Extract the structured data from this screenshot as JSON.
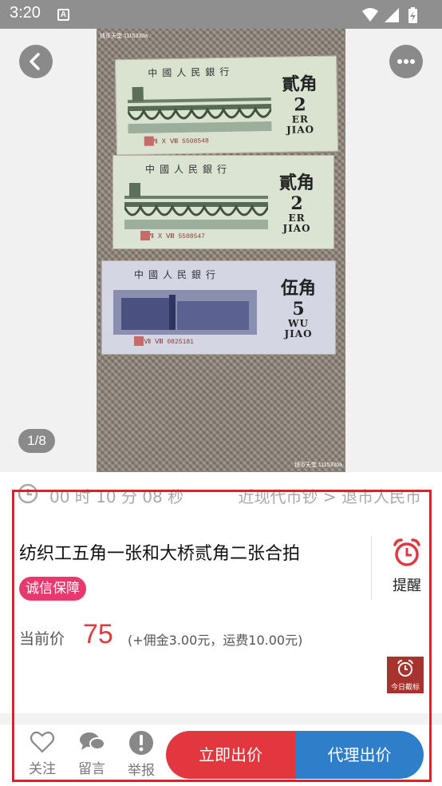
{
  "status_bar": {
    "time": "3:20",
    "a_indicator": "A",
    "icons": [
      "wifi-icon",
      "signal-icon",
      "battery-charging-icon"
    ]
  },
  "header": {
    "back_icon": "chevron-left-icon",
    "more_icon": "more-horizontal-icon"
  },
  "gallery": {
    "counter": "1/8",
    "photo_watermark": "钱币天堂 1115330a",
    "notes": [
      {
        "bank": "中國人民銀行",
        "value_cn": "貳角",
        "digit": "2",
        "roman_top": "ER",
        "roman_bottom": "JIAO",
        "serial": "Ⅶ Ⅹ Ⅷ 5508548",
        "color": "#d9e3cf"
      },
      {
        "bank": "中國人民銀行",
        "value_cn": "貳角",
        "digit": "2",
        "roman_top": "ER",
        "roman_bottom": "JIAO",
        "serial": "Ⅶ Ⅹ Ⅷ 5508547",
        "color": "#dbe4d2"
      },
      {
        "bank": "中國人民銀行",
        "value_cn": "伍角",
        "digit": "5",
        "roman_top": "WU",
        "roman_bottom": "JIAO",
        "serial": "Ⅴ Ⅶ Ⅷ 0825181",
        "color": "#d4d6e4"
      }
    ]
  },
  "auction": {
    "countdown": "00 时 10 分 08 秒",
    "breadcrumb": "近现代币钞 > 退市人民币",
    "title": "纺织工五角一张和大桥贰角二张合拍",
    "trust_badge": "诚信保障",
    "remind_label": "提醒",
    "price_label": "当前价",
    "price_value": "75",
    "price_fees": "(+佣金3.00元，运费10.00元)",
    "today_badge": "今日截标"
  },
  "bottom_bar": {
    "follow_label": "关注",
    "comment_label": "留言",
    "report_label": "举报",
    "bid_label": "立即出价",
    "proxy_label": "代理出价"
  },
  "colors": {
    "accent_red": "#e2373f",
    "accent_blue": "#2f7ec9",
    "badge_pink": "#e8386e",
    "annotation_frame": "#d9232a"
  }
}
